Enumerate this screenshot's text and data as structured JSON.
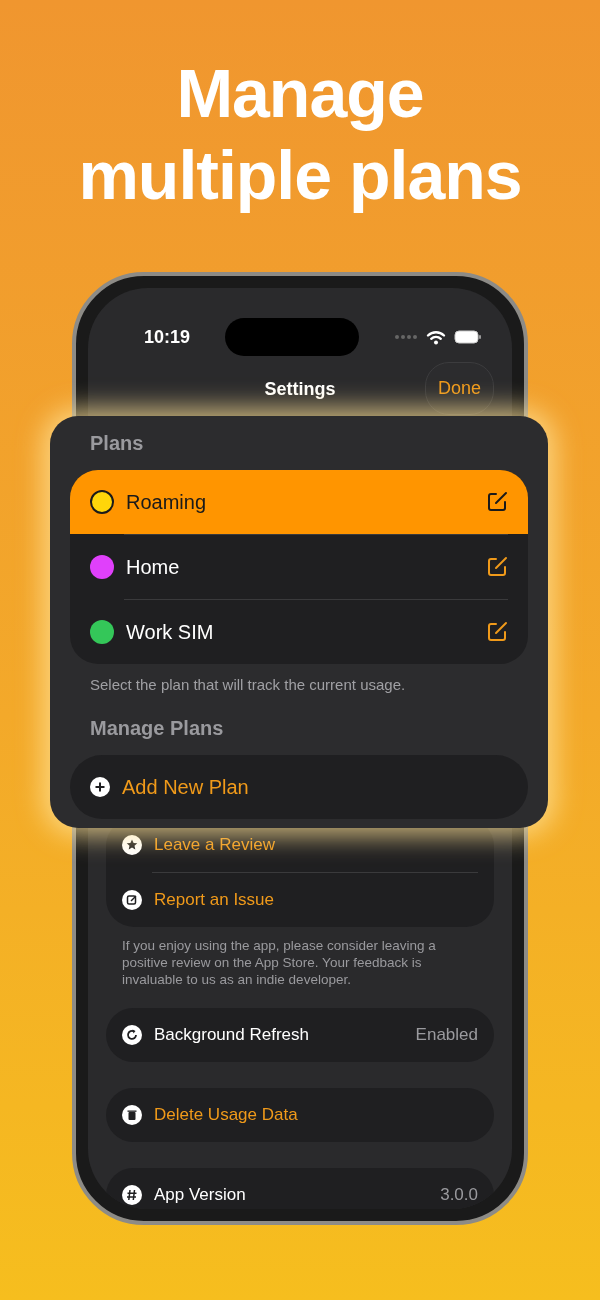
{
  "headline": [
    "Manage",
    "multiple plans"
  ],
  "status_bar": {
    "time": "10:19"
  },
  "nav": {
    "title": "Settings",
    "done": "Done"
  },
  "plans_panel": {
    "title": "Plans",
    "plans": [
      {
        "name": "Roaming",
        "color": "#ffd60a",
        "selected": true
      },
      {
        "name": "Home",
        "color": "#e040fb",
        "selected": false
      },
      {
        "name": "Work SIM",
        "color": "#34c759",
        "selected": false
      }
    ],
    "footer": "Select the plan that will track the current usage.",
    "manage_title": "Manage Plans",
    "add_button": "Add New Plan"
  },
  "support": {
    "items": [
      {
        "label": "Leave a Review"
      },
      {
        "label": "Report an Issue"
      }
    ],
    "footer": "If you enjoy using the app, please consider leaving a positive review on the App Store. Your feedback is invaluable to us as an indie developer."
  },
  "background_refresh": {
    "label": "Background Refresh",
    "value": "Enabled"
  },
  "delete_data": {
    "label": "Delete Usage Data"
  },
  "app_version": {
    "label": "App Version",
    "value": "3.0.0"
  }
}
